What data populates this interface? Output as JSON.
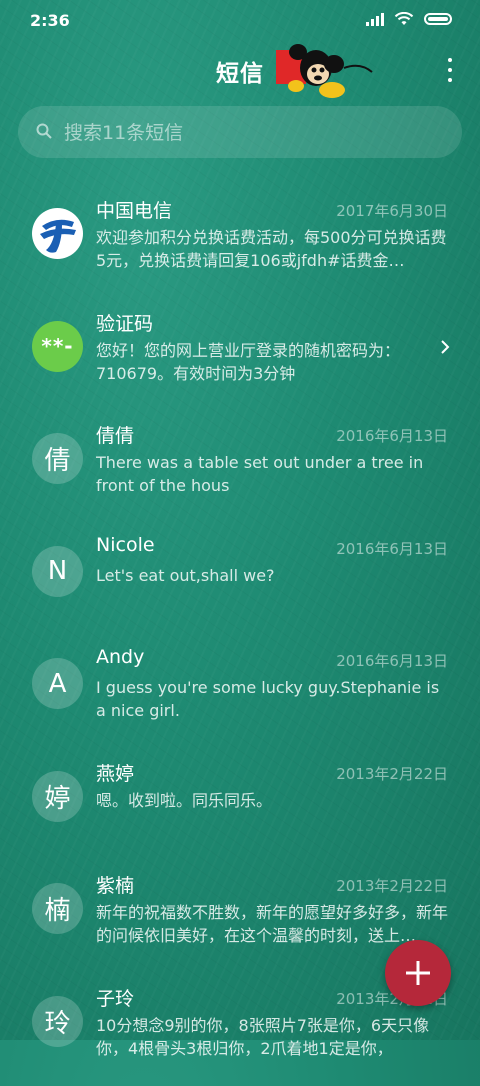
{
  "status_bar": {
    "time": "2:36",
    "icons": [
      "signal-icon",
      "wifi-icon",
      "battery-icon"
    ]
  },
  "header": {
    "title": "短信",
    "menu_icon": "more-vertical-icon"
  },
  "search": {
    "placeholder": "搜索11条短信",
    "icon": "search-icon"
  },
  "conversations": [
    {
      "name": "中国电信",
      "date": "2017年6月30日",
      "preview": "欢迎参加积分兑换话费活动，每500分可兑换话费5元，兑换话费请回复106或jfdh#话费金…",
      "avatar": "",
      "avatar_type": "telecom-logo"
    },
    {
      "name": "验证码",
      "date": "",
      "preview": "您好！您的网上营业厅登录的随机密码为：710679。有效时间为3分钟",
      "avatar": "**-",
      "avatar_type": "code"
    },
    {
      "name": "倩倩",
      "date": "2016年6月13日",
      "preview": "There was a table set out under a tree in front of the hous",
      "avatar": "倩",
      "avatar_type": "letter"
    },
    {
      "name": "Nicole",
      "date": "2016年6月13日",
      "preview": "Let's eat out,shall we?",
      "avatar": "N",
      "avatar_type": "letter"
    },
    {
      "name": "Andy",
      "date": "2016年6月13日",
      "preview": "I guess you're some lucky guy.Stephanie is a nice girl.",
      "avatar": "A",
      "avatar_type": "letter"
    },
    {
      "name": "燕婷",
      "date": "2013年2月22日",
      "preview": "嗯。收到啦。同乐同乐。",
      "avatar": "婷",
      "avatar_type": "letter"
    },
    {
      "name": "紫楠",
      "date": "2013年2月22日",
      "preview": "新年的祝福数不胜数，新年的愿望好多好多，新年的问候依旧美好，在这个温馨的时刻，送上…",
      "avatar": "楠",
      "avatar_type": "letter"
    },
    {
      "name": "子玲",
      "date": "2013年2月22日",
      "preview": "10分想念9别的你，8张照片7张是你，6天只像你，4根骨头3根归你，2爪着地1定是你，",
      "avatar": "玲",
      "avatar_type": "letter"
    }
  ],
  "fab": {
    "icon": "plus-icon",
    "color": "#b5283a"
  },
  "colors": {
    "background": "#1e8a72",
    "accent_green": "#6bcc4a"
  }
}
